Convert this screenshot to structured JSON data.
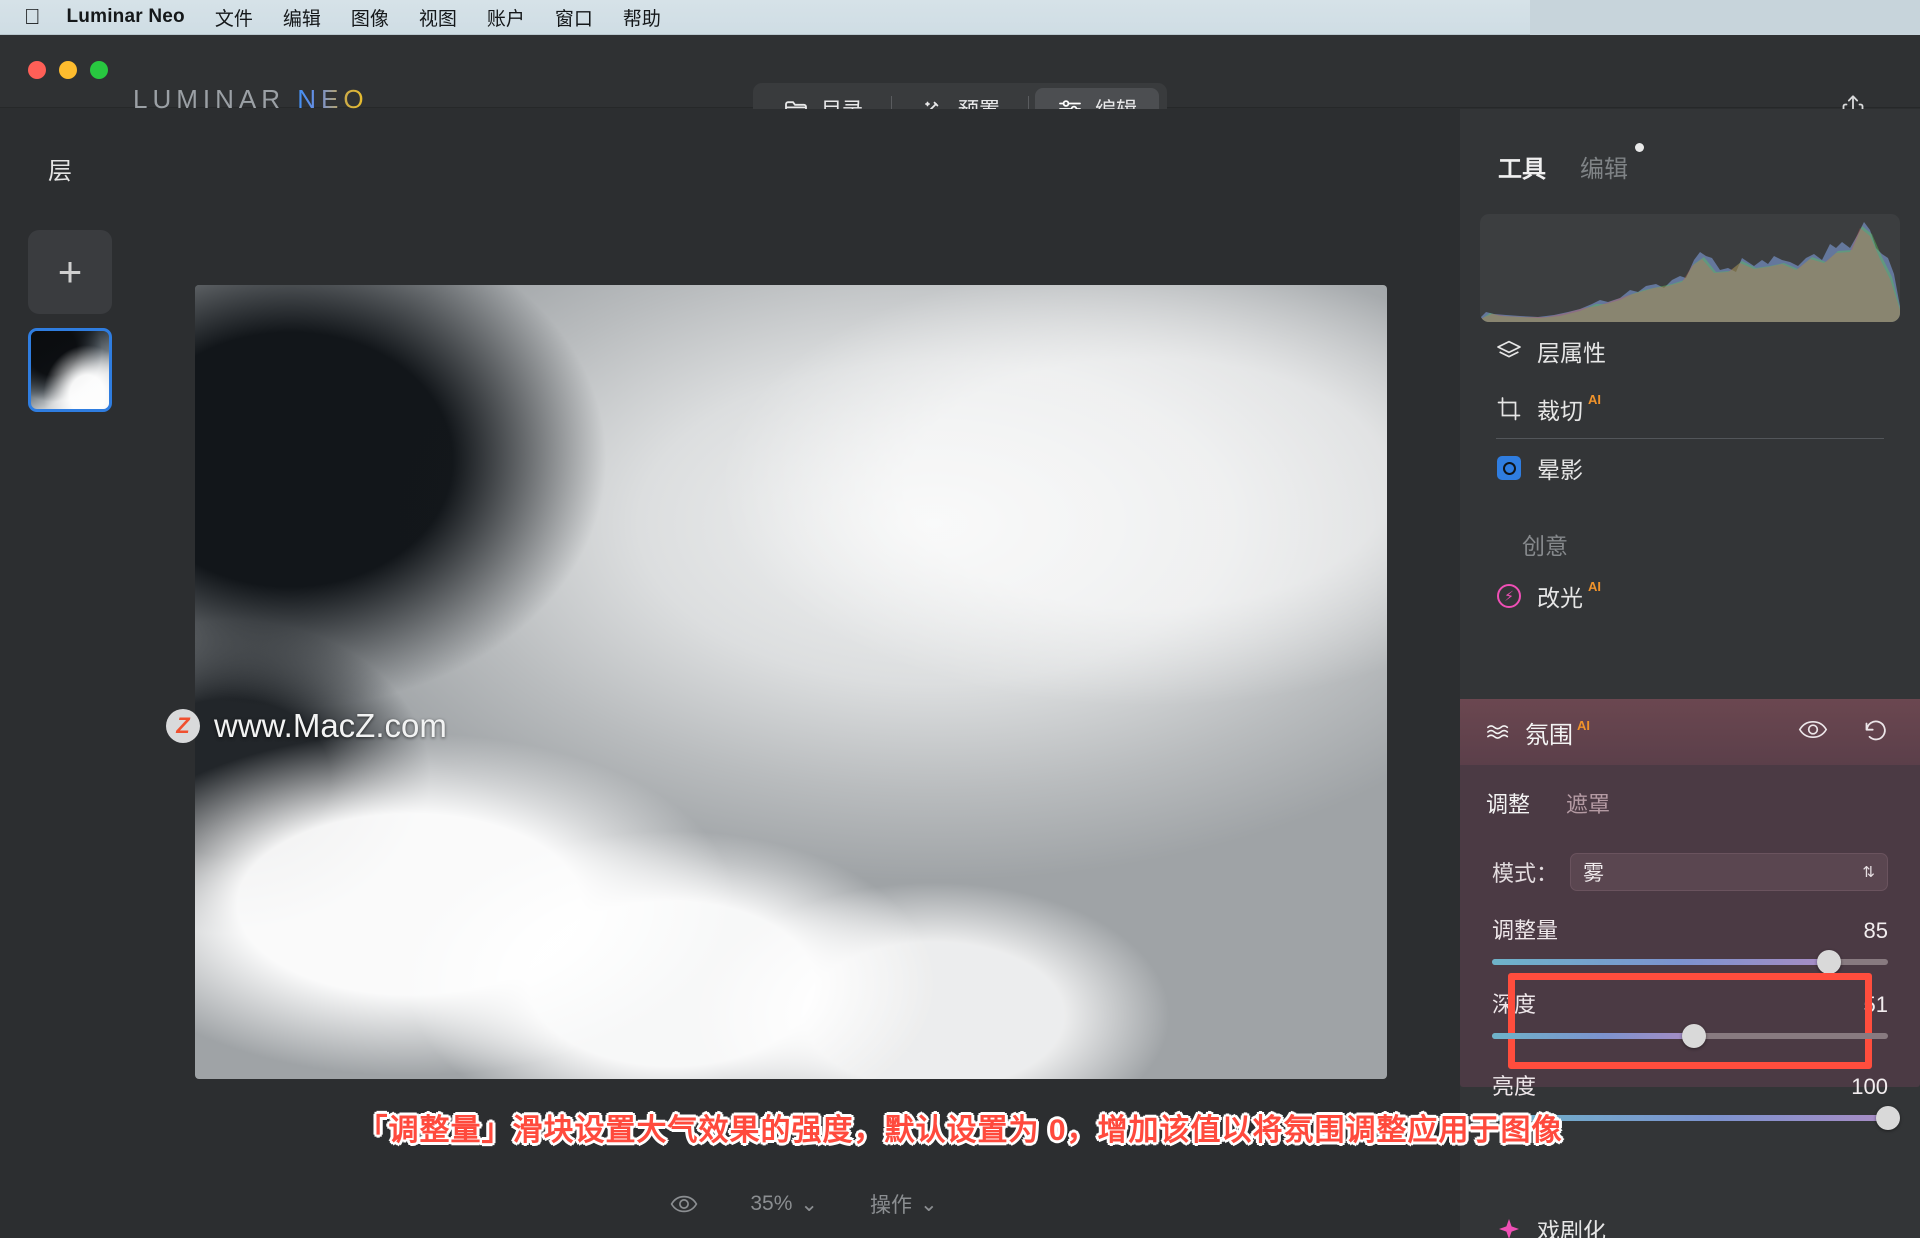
{
  "menubar": {
    "apple_icon": "apple-logo-icon",
    "app_name": "Luminar Neo",
    "items": [
      "文件",
      "编辑",
      "图像",
      "视图",
      "账户",
      "窗口",
      "帮助"
    ]
  },
  "titlebar": {
    "logo_first": "LUMINAR",
    "logo_second": "NEO",
    "modes": [
      {
        "label": "目录",
        "icon": "folder-icon",
        "active": false
      },
      {
        "label": "预置",
        "icon": "sparkle-icon",
        "active": false
      },
      {
        "label": "编辑",
        "icon": "sliders-icon",
        "active": true
      }
    ],
    "share_icon": "share-upload-icon"
  },
  "layers": {
    "title": "层",
    "add_label": "+"
  },
  "canvas": {
    "watermark_badge": "Z",
    "watermark_text": "www.MacZ.com",
    "bottom": {
      "eye_icon": "eye-icon",
      "zoom_level": "35%",
      "actions_label": "操作"
    }
  },
  "tools": {
    "tabs": [
      {
        "label": "工具",
        "active": true
      },
      {
        "label": "编辑",
        "active": false,
        "has_dot": true
      }
    ],
    "essentials": [
      {
        "label": "层属性",
        "icon": "layers-icon",
        "ai": false
      },
      {
        "label": "裁切",
        "icon": "crop-icon",
        "ai": true
      },
      {
        "label": "晕影",
        "icon": "vignette-icon",
        "ai": false
      }
    ],
    "creative_section_label": "创意",
    "creative": [
      {
        "label": "改光",
        "icon": "relight-icon",
        "ai": true
      }
    ],
    "bottom_item": {
      "label": "戏剧化",
      "icon": "dramatic-icon"
    }
  },
  "atmosphere": {
    "title": "氛围",
    "ai_badge": "AI",
    "icon": "waves-icon",
    "eye_icon": "eye-icon",
    "reset_icon": "undo-icon",
    "tabs": [
      {
        "label": "调整",
        "active": true
      },
      {
        "label": "遮罩",
        "active": false
      }
    ],
    "mode_label": "模式：",
    "mode_value": "雾",
    "sliders": [
      {
        "name": "调整量",
        "value": "85",
        "percent": 85,
        "highlighted": false
      },
      {
        "name": "深度",
        "value": "51",
        "percent": 51,
        "highlighted": true
      },
      {
        "name": "亮度",
        "value": "100",
        "percent": 100,
        "highlighted": false
      }
    ]
  },
  "caption": {
    "text": "「调整量」滑块设置大气效果的强度，默认设置为 0，增加该值以将氛围调整应用于图像"
  },
  "colors": {
    "accent_blue": "#2f7de0",
    "ai_orange": "#f0932b",
    "highlight_red": "#ff4d3d",
    "panel_purple": "#4b3a44"
  }
}
